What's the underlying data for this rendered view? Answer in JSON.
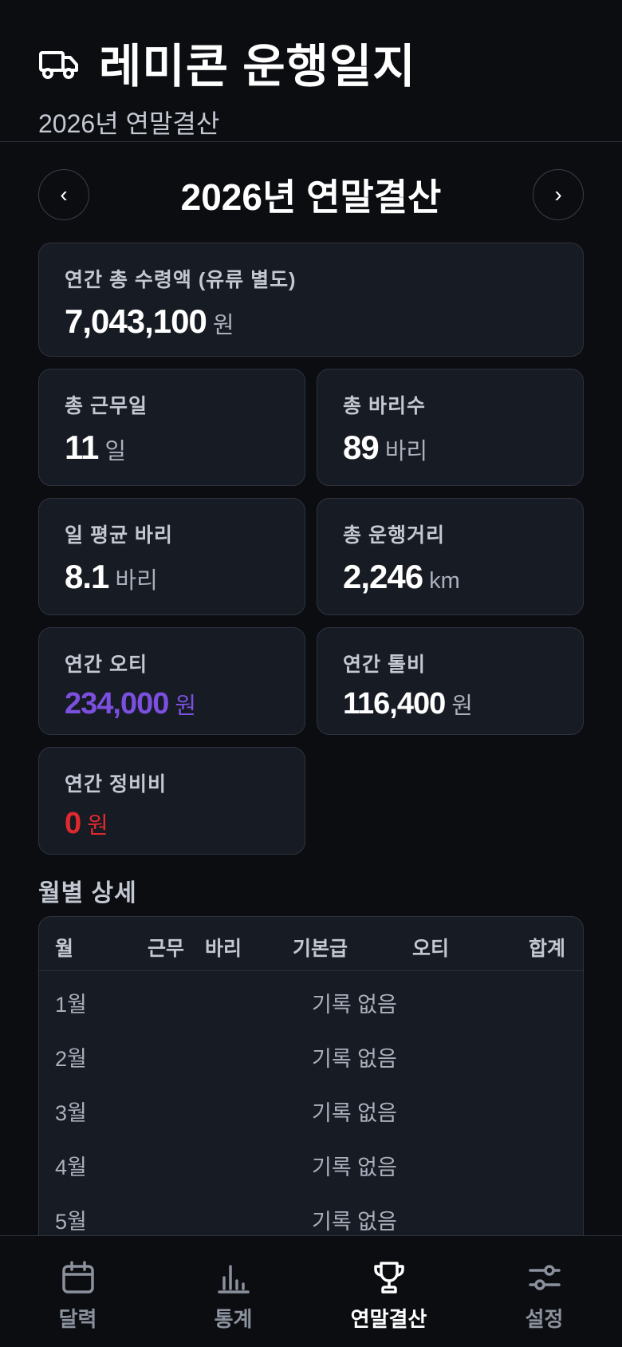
{
  "header": {
    "title": "레미콘 운행일지",
    "subtitle": "2026년 연말결산",
    "icon": "truck-icon"
  },
  "year_nav": {
    "prev_label": "‹",
    "next_label": "›",
    "title": "2026년 연말결산"
  },
  "summary": {
    "total_income": {
      "label": "연간 총 수령액 (유류 별도)",
      "value": "7,043,100",
      "unit": "원"
    },
    "work_days": {
      "label": "총 근무일",
      "value": "11",
      "unit": "일"
    },
    "total_loads": {
      "label": "총 바리수",
      "value": "89",
      "unit": "바리"
    },
    "daily_avg_loads": {
      "label": "일 평균 바리",
      "value": "8.1",
      "unit": "바리"
    },
    "total_distance": {
      "label": "총 운행거리",
      "value": "2,246",
      "unit": "km"
    },
    "annual_overtime": {
      "label": "연간 오티",
      "value": "234,000",
      "unit": "원",
      "color": "#7b4fe0"
    },
    "annual_toll": {
      "label": "연간 톨비",
      "value": "116,400",
      "unit": "원"
    },
    "annual_maintenance": {
      "label": "연간 정비비",
      "value": "0",
      "unit": "원",
      "color": "#e0292f"
    }
  },
  "monthly": {
    "section_title": "월별 상세",
    "columns": [
      "월",
      "근무",
      "바리",
      "기본급",
      "오티",
      "합계"
    ],
    "rows": [
      {
        "month": "1월",
        "status": "기록 없음"
      },
      {
        "month": "2월",
        "status": "기록 없음"
      },
      {
        "month": "3월",
        "status": "기록 없음"
      },
      {
        "month": "4월",
        "status": "기록 없음"
      },
      {
        "month": "5월",
        "status": "기록 없음"
      }
    ]
  },
  "bottom_nav": {
    "items": [
      {
        "label": "달력",
        "icon": "calendar-icon",
        "active": false
      },
      {
        "label": "통계",
        "icon": "bar-chart-icon",
        "active": false
      },
      {
        "label": "연말결산",
        "icon": "trophy-icon",
        "active": true
      },
      {
        "label": "설정",
        "icon": "sliders-icon",
        "active": false
      }
    ]
  }
}
